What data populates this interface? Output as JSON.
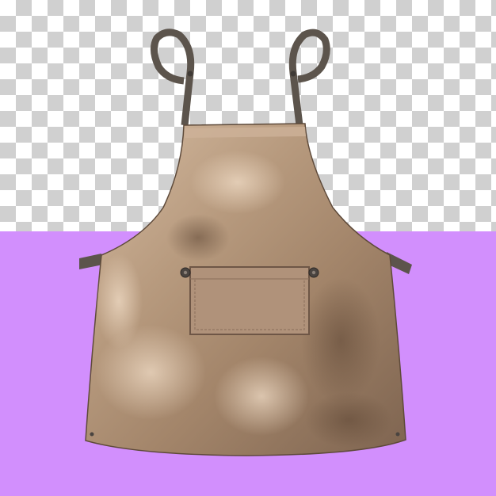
{
  "scene": {
    "subject": "apron-icon",
    "colors": {
      "backdrop": "#d28ffd",
      "checker_light": "#ffffff",
      "checker_dark": "#d0d0d0",
      "fabric_light": "#c9ad92",
      "fabric_mid": "#a98b70",
      "fabric_dark": "#7a5f49",
      "strap": "#5c544c",
      "rivet": "#4a4440"
    }
  }
}
